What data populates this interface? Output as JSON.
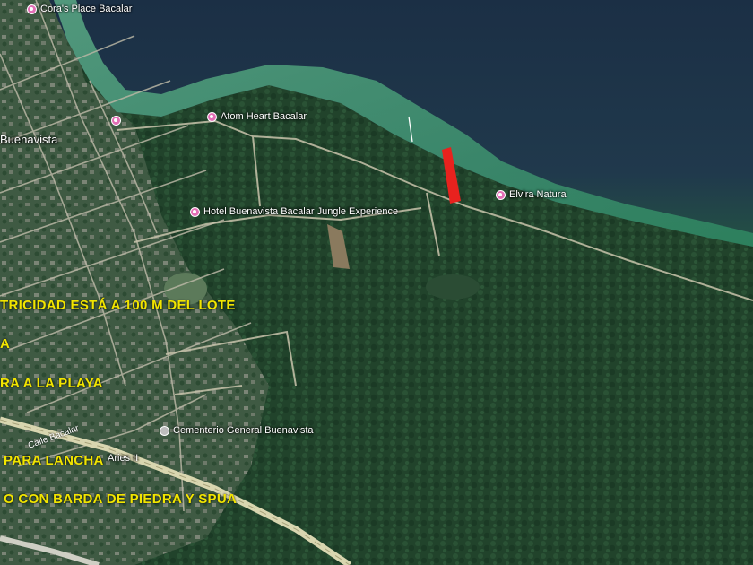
{
  "colors": {
    "lagoon_deep": "#1f3548",
    "lagoon_shallow": "#3fa274",
    "forest": "#22452c",
    "settlement": "#4a5e4a",
    "lot_marker": "#e8221e",
    "note_text": "#f2e500",
    "poi_pin": "#e36fb6"
  },
  "pois": [
    {
      "name": "Cora's Place Bacalar",
      "icon": "pink-pin-icon"
    },
    {
      "name": "Atom Heart Bacalar",
      "icon": "pink-pin-icon"
    },
    {
      "name": "Hotel Buenavista Bacalar Jungle Experience",
      "icon": "pink-pin-icon"
    },
    {
      "name": "Elvira Natura",
      "icon": "pink-pin-icon"
    },
    {
      "name": "Cementerio General Buenavista",
      "icon": "grey-pin-icon"
    },
    {
      "name": "Aries II",
      "icon": "none"
    }
  ],
  "area_label": "Buenavista",
  "road_label": "Calle Bacalar",
  "notes": [
    "TRICIDAD ESTÁ A 100 M DEL LOTE",
    "A",
    "RA A LA PLAYA",
    "PARA LANCHA",
    "O CON BARDA DE PIEDRA Y SPUA"
  ]
}
